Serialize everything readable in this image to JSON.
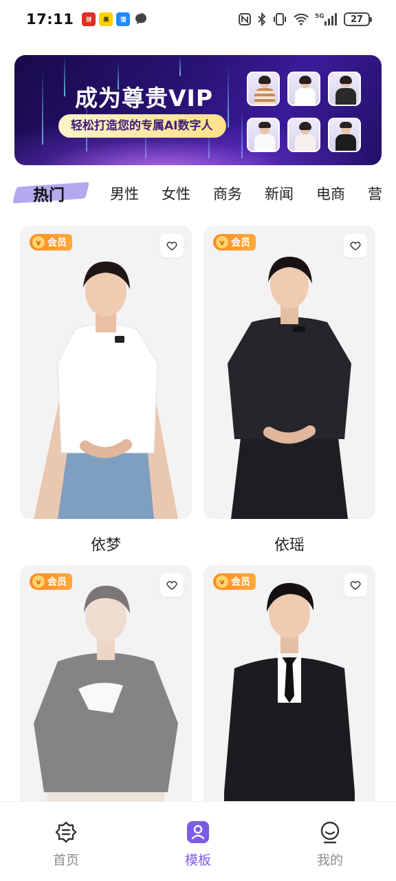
{
  "status_bar": {
    "time": "17:11",
    "notifications": [
      "pinduoduo-icon",
      "meituan-icon",
      "eleme-icon",
      "message-icon"
    ],
    "system_icons": [
      "nfc-icon",
      "bluetooth-icon",
      "vibrate-icon",
      "wifi-icon",
      "signal-5g-icon"
    ],
    "network": "5G",
    "battery": "27"
  },
  "banner": {
    "title": "成为尊贵VIP",
    "subtitle": "轻松打造您的专属AI数字人"
  },
  "tabs": [
    {
      "label": "热门",
      "active": true
    },
    {
      "label": "男性",
      "active": false
    },
    {
      "label": "女性",
      "active": false
    },
    {
      "label": "商务",
      "active": false
    },
    {
      "label": "新闻",
      "active": false
    },
    {
      "label": "电商",
      "active": false
    },
    {
      "label": "营",
      "active": false
    }
  ],
  "cards": [
    {
      "name": "依梦",
      "badge": "会员",
      "badge_v": "v"
    },
    {
      "name": "依瑶",
      "badge": "会员",
      "badge_v": "v"
    },
    {
      "name": "",
      "badge": "会员",
      "badge_v": "v"
    },
    {
      "name": "",
      "badge": "会员",
      "badge_v": "v"
    }
  ],
  "bottom_nav": [
    {
      "label": "首页",
      "icon": "home-icon",
      "active": false
    },
    {
      "label": "模板",
      "icon": "template-icon",
      "active": true
    },
    {
      "label": "我的",
      "icon": "profile-icon",
      "active": false
    }
  ],
  "colors": {
    "accent": "#7a5ce8",
    "vip_orange": "#ff8a1f",
    "banner_bg": "#2a1375",
    "tab_highlight": "#b6a8ee"
  }
}
